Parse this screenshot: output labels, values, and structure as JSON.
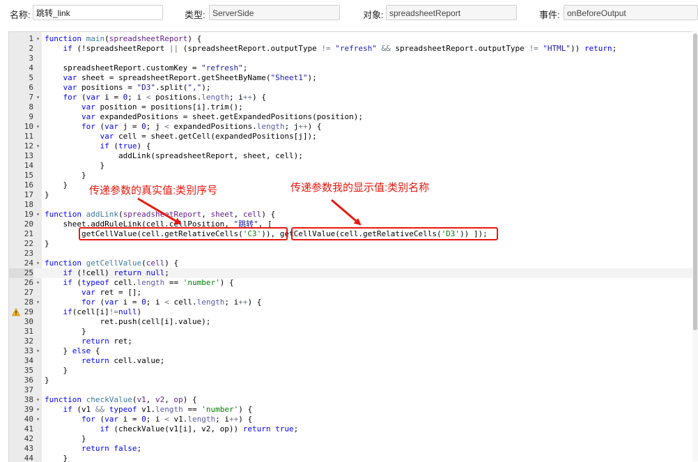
{
  "header": {
    "name_label": "名称:",
    "name_value": "跳转_link",
    "type_label": "类型:",
    "type_value": "ServerSide",
    "object_label": "对象:",
    "object_value": "spreadsheetReport",
    "event_label": "事件:",
    "event_value": "onBeforeOutput"
  },
  "editor": {
    "active_line": 25,
    "warning_line": 29,
    "lines": [
      {
        "n": 1,
        "fold": true,
        "html": "<span class=\"kw\">function</span> <span class=\"fn\">main</span>(<span class=\"prm\">spreadsheetReport</span>) {"
      },
      {
        "n": 2,
        "fold": false,
        "html": "    <span class=\"kw\">if</span> (!spreadsheetReport <span class=\"op\">||</span> (spreadsheetReport.outputType <span class=\"op\">!=</span> <span class=\"str\">\"refresh\"</span> <span class=\"op\">&amp;&amp;</span> spreadsheetReport.outputType <span class=\"op\">!=</span> <span class=\"str\">\"HTML\"</span>)) <span class=\"kw\">return</span>;"
      },
      {
        "n": 3,
        "fold": false,
        "html": ""
      },
      {
        "n": 4,
        "fold": false,
        "html": "    spreadsheetReport.customKey = <span class=\"str\">\"refresh\"</span>;"
      },
      {
        "n": 5,
        "fold": false,
        "html": "    <span class=\"kw\">var</span> sheet = spreadsheetReport.getSheetByName(<span class=\"str\">\"Sheet1\"</span>);"
      },
      {
        "n": 6,
        "fold": false,
        "html": "    <span class=\"kw\">var</span> positions = <span class=\"str\">\"D3\"</span>.split(<span class=\"str\">\",\"</span>);"
      },
      {
        "n": 7,
        "fold": true,
        "html": "    <span class=\"kw\">for</span> (<span class=\"kw\">var</span> i = <span class=\"num\">0</span>; i <span class=\"op\">&lt;</span> positions.<span class=\"builtin\">length</span>; i<span class=\"op\">++</span>) {"
      },
      {
        "n": 8,
        "fold": false,
        "html": "        <span class=\"kw\">var</span> position = positions[i].trim();"
      },
      {
        "n": 9,
        "fold": false,
        "html": "        <span class=\"kw\">var</span> expandedPositions = sheet.getExpandedPositions(position);"
      },
      {
        "n": 10,
        "fold": true,
        "html": "        <span class=\"kw\">for</span> (<span class=\"kw\">var</span> j = <span class=\"num\">0</span>; j <span class=\"op\">&lt;</span> expandedPositions.<span class=\"builtin\">length</span>; j<span class=\"op\">++</span>) {"
      },
      {
        "n": 11,
        "fold": false,
        "html": "            <span class=\"kw\">var</span> cell = sheet.getCell(expandedPositions[j]);"
      },
      {
        "n": 12,
        "fold": true,
        "html": "            <span class=\"kw\">if</span> (<span class=\"kw\">true</span>) {"
      },
      {
        "n": 13,
        "fold": false,
        "html": "                addLink(spreadsheetReport, sheet, cell);"
      },
      {
        "n": 14,
        "fold": false,
        "html": "            }"
      },
      {
        "n": 15,
        "fold": false,
        "html": "        }"
      },
      {
        "n": 16,
        "fold": false,
        "html": "    }"
      },
      {
        "n": 17,
        "fold": false,
        "html": "}"
      },
      {
        "n": 18,
        "fold": false,
        "html": ""
      },
      {
        "n": 19,
        "fold": true,
        "html": "<span class=\"kw\">function</span> <span class=\"fn\">addLink</span>(<span class=\"prm\">spreadsheetReport</span>, <span class=\"prm\">sheet</span>, <span class=\"prm\">cell</span>) {"
      },
      {
        "n": 20,
        "fold": false,
        "html": "    sheet.addRuleLink(cell.cellPosition, <span class=\"str\">\"跳转\"</span>, ["
      },
      {
        "n": 21,
        "fold": false,
        "html": "        getCellValue(cell.getRelativeCells(<span class=\"str2\">'C3'</span>)), getCellValue(cell.getRelativeCells(<span class=\"str2\">'D3'</span>)) ]);"
      },
      {
        "n": 22,
        "fold": false,
        "html": "}"
      },
      {
        "n": 23,
        "fold": false,
        "html": ""
      },
      {
        "n": 24,
        "fold": true,
        "html": "<span class=\"kw\">function</span> <span class=\"fn\">getCellValue</span>(<span class=\"prm\">cell</span>) {"
      },
      {
        "n": 25,
        "fold": false,
        "html": "    <span class=\"kw\">if</span> (!cell) <span class=\"kw\">return</span> <span class=\"kw\">null</span>;"
      },
      {
        "n": 26,
        "fold": true,
        "html": "    <span class=\"kw\">if</span> (<span class=\"kw\">typeof</span> cell.<span class=\"builtin\">length</span> == <span class=\"str2\">'number'</span>) {"
      },
      {
        "n": 27,
        "fold": false,
        "html": "        <span class=\"kw\">var</span> ret = [];"
      },
      {
        "n": 28,
        "fold": true,
        "html": "        <span class=\"kw\">for</span> (<span class=\"kw\">var</span> i = <span class=\"num\">0</span>; i <span class=\"op\">&lt;</span> cell.<span class=\"builtin\">length</span>; i<span class=\"op\">++</span>) {"
      },
      {
        "n": 29,
        "fold": false,
        "html": "    <span class=\"kw\">if</span>(cell[i]<span class=\"op\">!=</span><span class=\"kw\">null</span>)"
      },
      {
        "n": 30,
        "fold": false,
        "html": "            ret.push(cell[i].value);"
      },
      {
        "n": 31,
        "fold": false,
        "html": "        }"
      },
      {
        "n": 32,
        "fold": false,
        "html": "        <span class=\"kw\">return</span> ret;"
      },
      {
        "n": 33,
        "fold": true,
        "html": "    } <span class=\"kw\">else</span> {"
      },
      {
        "n": 34,
        "fold": false,
        "html": "        <span class=\"kw\">return</span> cell.value;"
      },
      {
        "n": 35,
        "fold": false,
        "html": "    }"
      },
      {
        "n": 36,
        "fold": false,
        "html": "}"
      },
      {
        "n": 37,
        "fold": false,
        "html": ""
      },
      {
        "n": 38,
        "fold": true,
        "html": "<span class=\"kw\">function</span> <span class=\"fn\">checkValue</span>(<span class=\"prm\">v1</span>, <span class=\"prm\">v2</span>, <span class=\"prm\">op</span>) {"
      },
      {
        "n": 39,
        "fold": true,
        "html": "    <span class=\"kw\">if</span> (v1 <span class=\"op\">&amp;&amp;</span> <span class=\"kw\">typeof</span> v1.<span class=\"builtin\">length</span> == <span class=\"str2\">'number'</span>) {"
      },
      {
        "n": 40,
        "fold": true,
        "html": "        <span class=\"kw\">for</span> (<span class=\"kw\">var</span> i = <span class=\"num\">0</span>; i <span class=\"op\">&lt;</span> v1.<span class=\"builtin\">length</span>; i<span class=\"op\">++</span>) {"
      },
      {
        "n": 41,
        "fold": false,
        "html": "            <span class=\"kw\">if</span> (checkValue(v1[i], v2, op)) <span class=\"kw\">return</span> <span class=\"kw\">true</span>;"
      },
      {
        "n": 42,
        "fold": false,
        "html": "        }"
      },
      {
        "n": 43,
        "fold": false,
        "html": "        <span class=\"kw\">return</span> <span class=\"kw\">false</span>;"
      },
      {
        "n": 44,
        "fold": false,
        "html": "    }"
      }
    ]
  },
  "annotations": {
    "left_note": "传递参数的真实值:类别序号",
    "right_note": "传递参数我的显示值:类别名称",
    "color": "#e8170d"
  }
}
